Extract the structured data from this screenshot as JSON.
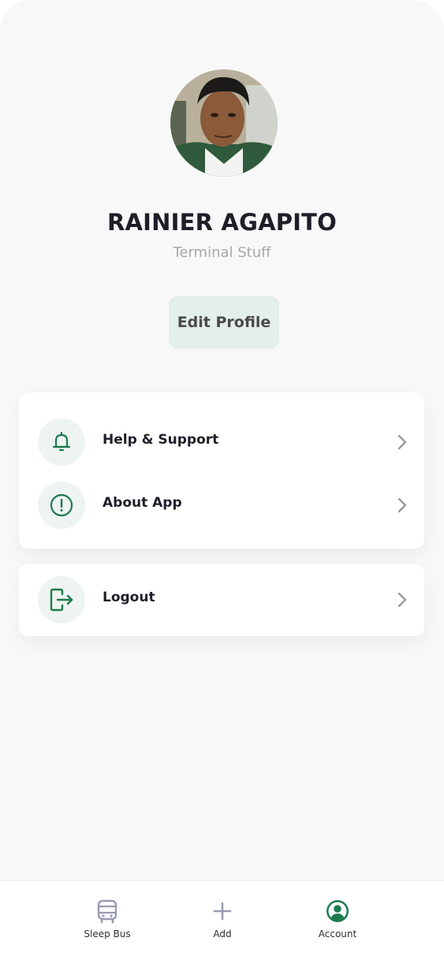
{
  "profile": {
    "name": "RAINIER AGAPITO",
    "role": "Terminal Stuff",
    "edit_label": "Edit Profile"
  },
  "menu": {
    "items": [
      {
        "label": "Help & Support",
        "icon": "bell-icon"
      },
      {
        "label": "About App",
        "icon": "info-icon"
      }
    ],
    "logout": {
      "label": "Logout",
      "icon": "logout-icon"
    }
  },
  "nav": {
    "items": [
      {
        "label": "Sleep Bus",
        "icon": "bus-icon",
        "active": false
      },
      {
        "label": "Add",
        "icon": "plus-icon",
        "active": false
      },
      {
        "label": "Account",
        "icon": "account-icon",
        "active": true
      }
    ]
  },
  "colors": {
    "accent": "#1e7a50",
    "icon_bg": "#eef4f1",
    "edit_button_bg": "#e4eeeb",
    "inactive_nav": "#9a9ab4"
  }
}
